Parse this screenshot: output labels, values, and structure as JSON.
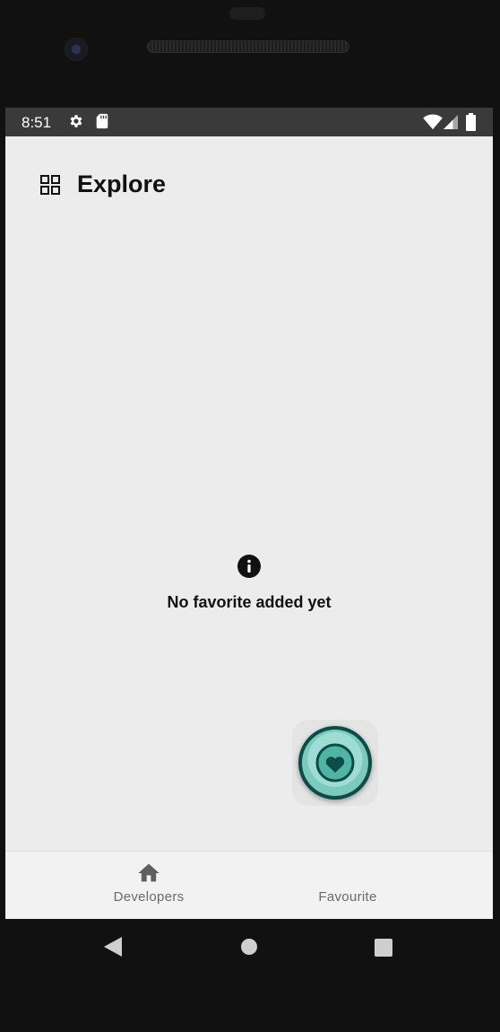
{
  "status_bar": {
    "time": "8:51",
    "left_icons": [
      "gear-icon",
      "sd-card-icon"
    ],
    "right_icons": [
      "wifi-icon",
      "signal-icon",
      "battery-icon"
    ]
  },
  "header": {
    "title": "Explore",
    "icon": "grid-icon"
  },
  "empty_state": {
    "icon": "info-icon",
    "message": "No favorite added yet"
  },
  "bottom_nav": {
    "items": [
      {
        "label": "Developers",
        "icon": "home-icon",
        "active": false
      },
      {
        "label": "Favourite",
        "icon": "heart-icon",
        "active": true
      }
    ]
  },
  "system_nav": {
    "buttons": [
      "back-icon",
      "home-circle-icon",
      "recents-icon"
    ]
  },
  "colors": {
    "accent": "#0d4d48",
    "accent_light": "#9fdcd3",
    "background": "#ececec",
    "status_bar": "#3a3a3a"
  }
}
